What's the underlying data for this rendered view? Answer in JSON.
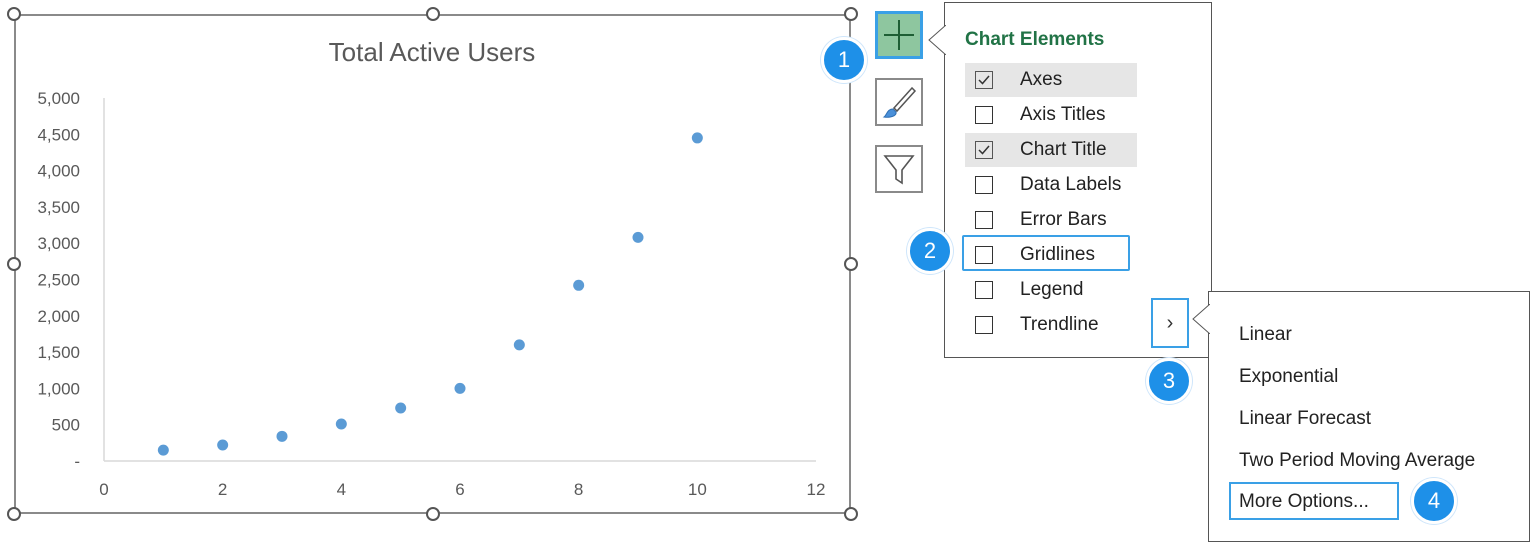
{
  "chart_data": {
    "type": "scatter",
    "title": "Total Active Users",
    "x": [
      1,
      2,
      3,
      4,
      5,
      6,
      7,
      8,
      9,
      10
    ],
    "y": [
      150,
      220,
      340,
      510,
      730,
      1000,
      1600,
      2420,
      3080,
      4450
    ],
    "xlim": [
      0,
      12
    ],
    "ylim": [
      0,
      5000
    ],
    "x_ticks": [
      "0",
      "2",
      "4",
      "6",
      "8",
      "10",
      "12"
    ],
    "y_ticks": [
      "-",
      "500",
      "1,000",
      "1,500",
      "2,000",
      "2,500",
      "3,000",
      "3,500",
      "4,000",
      "4,500",
      "5,000"
    ],
    "grid": false,
    "marker_color": "#5b9bd5"
  },
  "side_buttons": {
    "add": "plus-icon",
    "styles": "paintbrush-icon",
    "filters": "filter-icon"
  },
  "callouts": [
    "1",
    "2",
    "3",
    "4"
  ],
  "chart_elements": {
    "title": "Chart Elements",
    "items": [
      {
        "label": "Axes",
        "checked": true
      },
      {
        "label": "Axis Titles",
        "checked": false
      },
      {
        "label": "Chart Title",
        "checked": true
      },
      {
        "label": "Data Labels",
        "checked": false
      },
      {
        "label": "Error Bars",
        "checked": false
      },
      {
        "label": "Gridlines",
        "checked": false
      },
      {
        "label": "Legend",
        "checked": false
      },
      {
        "label": "Trendline",
        "checked": false
      }
    ],
    "expand_arrow": "›"
  },
  "trendline_menu": {
    "items": [
      "Linear",
      "Exponential",
      "Linear Forecast",
      "Two Period Moving Average",
      "More Options..."
    ]
  },
  "colors": {
    "accent": "#1e90e8",
    "title_green": "#217346",
    "plus_button_bg": "#8ec69f"
  }
}
